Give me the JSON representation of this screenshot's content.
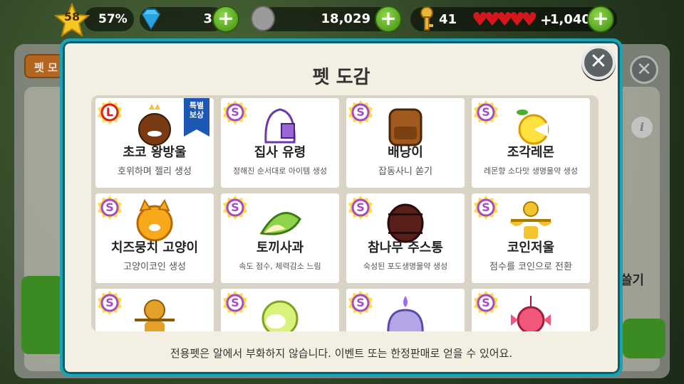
{
  "topbar": {
    "level": "58",
    "exp_percent": "57%",
    "gems": "3",
    "coins": "18,029",
    "keys": "41",
    "heart_plus": "+",
    "heart_count": "1,040",
    "plus_label": "+"
  },
  "background": {
    "tab_label": "펫 모",
    "right_text": "쓸기",
    "close_glyph": "✕",
    "info_glyph": "i"
  },
  "modal": {
    "title": "펫 도감",
    "close_glyph": "✕",
    "footer_note": "전용펫은 알에서 부화하지 않습니다. 이벤트 또는 한정판매로 얻을 수 있어요.",
    "special_badge": "특별\n보상",
    "pets": [
      {
        "name": "초코 왕방울",
        "desc": "호위하며 젤리 생성",
        "rank": "L",
        "icon": "choco-bell-icon"
      },
      {
        "name": "집사 유령",
        "desc": "정해진 순서대로 아이템 생성",
        "rank": "S",
        "icon": "butler-ghost-icon"
      },
      {
        "name": "배낭이",
        "desc": "잡동사니 쏟기",
        "rank": "S",
        "icon": "backpack-icon"
      },
      {
        "name": "조각레몬",
        "desc": "레몬향 소다맛 생명물약 생성",
        "rank": "S",
        "icon": "lemon-slice-icon"
      },
      {
        "name": "치즈뭉치 고양이",
        "desc": "고양이코인 생성",
        "rank": "S",
        "icon": "cheese-cat-icon"
      },
      {
        "name": "토끼사과",
        "desc": "속도 점수, 체력감소 느림",
        "rank": "S",
        "icon": "rabbit-apple-icon"
      },
      {
        "name": "참나무 주스통",
        "desc": "숙성된 포도생명물약 생성",
        "rank": "S",
        "icon": "oak-barrel-icon"
      },
      {
        "name": "코인저울",
        "desc": "점수를 코인으로 전환",
        "rank": "S",
        "icon": "coin-scale-icon"
      },
      {
        "name": "",
        "desc": "",
        "rank": "S",
        "icon": "bear-scale-icon"
      },
      {
        "name": "",
        "desc": "",
        "rank": "S",
        "icon": "green-orb-icon"
      },
      {
        "name": "",
        "desc": "",
        "rank": "S",
        "icon": "candle-spirit-icon"
      },
      {
        "name": "",
        "desc": "",
        "rank": "S",
        "icon": "pink-candy-icon"
      }
    ]
  },
  "colors": {
    "modal_border": "#1aa3b4",
    "modal_bg": "#f3efe3",
    "plus_green": "#5cb324",
    "heart_red": "#d5161c",
    "badge_s_purple": "#a44cc7",
    "badge_l_red": "#d91e1e"
  }
}
